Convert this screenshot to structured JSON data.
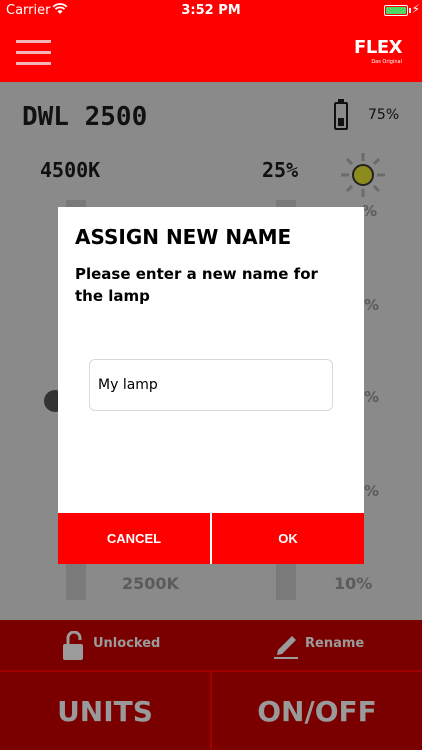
{
  "status_bar": {
    "carrier": "Carrier",
    "time": "3:52 PM"
  },
  "header": {
    "brand": "FLEX",
    "tagline": "Das Original"
  },
  "lamp": {
    "name": "DWL 2500",
    "battery_percent": "75%",
    "color_temperature": "4500K",
    "brightness": "25%",
    "partial_label_top_left": "4500K",
    "partial_right_1": "%",
    "partial_right_2": "%",
    "partial_right_3": "%",
    "partial_right_4": "%",
    "scale_bottom_left": "2500K",
    "scale_bottom_right": "10%"
  },
  "lock": {
    "label": "Unlocked"
  },
  "rename": {
    "label": "Rename"
  },
  "buttons": {
    "units": "UNITS",
    "on_off": "ON/OFF"
  },
  "dialog": {
    "title": "ASSIGN NEW NAME",
    "message": "Please enter a new name for the lamp",
    "input_value": "My lamp",
    "cancel_label": "CANCEL",
    "ok_label": "OK"
  },
  "colors": {
    "brand_red": "#ff0000",
    "dim_red": "#7a0000",
    "overlay_gray": "#8a8a8a"
  }
}
